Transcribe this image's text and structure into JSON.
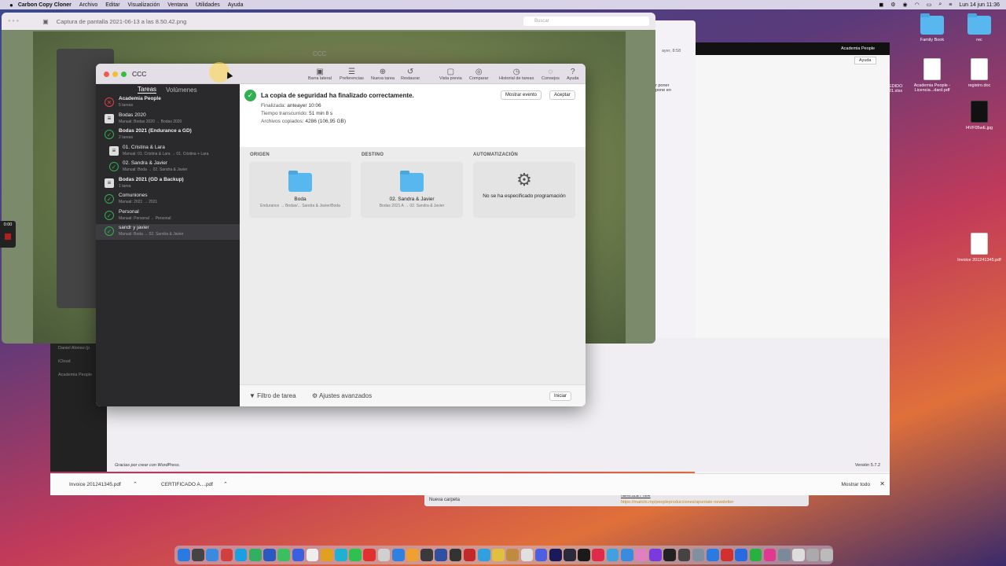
{
  "menubar": {
    "app_name": "Carbon Copy Cloner",
    "items": [
      "Archivo",
      "Editar",
      "Visualización",
      "Ventana",
      "Utilidades",
      "Ayuda"
    ],
    "clock": "Lun 14 jun  11:36"
  },
  "desktop": {
    "icons": [
      {
        "label": "Family Book",
        "kind": "folder"
      },
      {
        "label": "rec",
        "kind": "folder"
      },
      {
        "label": "Academia People - Licencia...dard.pdf",
        "kind": "doc"
      },
      {
        "label": "registro.doc",
        "kind": "doc"
      },
      {
        "label": "I4VF05wE.jpg",
        "kind": "doc"
      },
      {
        "label": "Invoice 201241345.pdf",
        "kind": "doc"
      }
    ],
    "partial_label": "EDIDO\n21.xlsx"
  },
  "preview_window": {
    "title": "Captura de pantalla 2021-06-13 a las 8.50.42.png",
    "search_placeholder": "Buscar"
  },
  "behind_ccc_title": "CCC",
  "browser": {
    "right_header_text": "Academia People",
    "help_label": "Ayuda",
    "snippet_1": "ayer, 8:58",
    "snippet_2": "r poner\npone en",
    "wp_footer": "Gracias por crear con WordPress.",
    "wp_version": "Versión 5.7.2",
    "sidebar_text_1": "Daniel Alonso (p",
    "sidebar_text_2": "iCloud",
    "sidebar_text_3": "Academia People"
  },
  "downloads_bar": {
    "files": [
      "Invoice 201241345.pdf",
      "CERTIFICADO A....pdf"
    ],
    "show_all": "Mostrar todo"
  },
  "finder_bottom": {
    "new_folder": "Nueva carpeta",
    "newsletter_title": "NEWSLETTER",
    "newsletter_link": "https://mailchi.mp/peopleproducciones/apuntate-newsletter"
  },
  "timer": "0:00",
  "ccc": {
    "title": "CCC",
    "toolbar": [
      {
        "label": "Barra lateral",
        "icon": "sidebar-icon",
        "glyph": "▣"
      },
      {
        "label": "Preferencias",
        "icon": "preferences-icon",
        "glyph": "☰"
      },
      {
        "label": "Nueva tarea",
        "icon": "plus-icon",
        "glyph": "⊕"
      },
      {
        "label": "Restaurar",
        "icon": "restore-icon",
        "glyph": "↺"
      },
      {
        "label": "Vista previa",
        "icon": "preview-icon",
        "glyph": "▢"
      },
      {
        "label": "Comparar",
        "icon": "compare-icon",
        "glyph": "◎"
      },
      {
        "label": "Historial de tareas",
        "icon": "history-icon",
        "glyph": "◷"
      },
      {
        "label": "Consejos",
        "icon": "tips-icon",
        "glyph": "◌"
      },
      {
        "label": "Ayuda",
        "icon": "help-icon",
        "glyph": "?"
      }
    ],
    "sidebar": {
      "tab_tasks": "Tareas",
      "tab_volumes": "Volúmenes",
      "tasks": [
        {
          "name": "Academia People",
          "sub": "5 tareas",
          "status": "error",
          "kind": "group"
        },
        {
          "name": "Bodas 2020",
          "sub": "Manual: Bodas 2020 → Bodas 2020",
          "status": "stack",
          "kind": "task"
        },
        {
          "name": "Bodas 2021 (Endurance a GD)",
          "sub": "2 tareas",
          "status": "ok",
          "kind": "group"
        },
        {
          "name": "01. Cristina & Lara",
          "sub": "Manual: 01. Cristina & Lara → 01. Cristina + Lara",
          "status": "stack",
          "kind": "sub"
        },
        {
          "name": "02. Sandra & Javier",
          "sub": "Manual: Boda → 02. Sandra & Javier",
          "status": "ok",
          "kind": "sub"
        },
        {
          "name": "Bodas 2021 (GD a Backup)",
          "sub": "1 tarea",
          "status": "stack",
          "kind": "group"
        },
        {
          "name": "Comuniones",
          "sub": "Manual: 2021 → 2021",
          "status": "ok",
          "kind": "task"
        },
        {
          "name": "Personal",
          "sub": "Manual: Personal → Personal",
          "status": "ok",
          "kind": "task"
        },
        {
          "name": "sandr y javier",
          "sub": "Manual: Boda → 02. Sandra & Javier",
          "status": "ok",
          "kind": "task",
          "selected": true
        }
      ]
    },
    "status": {
      "message": "La copia de seguridad ha finalizado correctamente.",
      "finished_label": "Finalizada",
      "finished_value": ": anteayer 10:06",
      "elapsed_label": "Tiempo transcurrido",
      "elapsed_value": ": 51 min 8 s",
      "files_label": "Archivos copiados",
      "files_value": ": 4286 (106,95 GB)",
      "show_event": "Mostrar evento",
      "accept": "Aceptar"
    },
    "source": {
      "header": "ORIGEN",
      "name": "Boda",
      "path": "Endurance → Bodas/... Sandra & Javier/Boda"
    },
    "destination": {
      "header": "DESTINO",
      "name": "02. Sandra & Javier",
      "path": "Bodas 2021 A → 02. Sandra & Javier"
    },
    "automation": {
      "header": "AUTOMATIZACIÓN",
      "text": "No se ha especificado programación"
    },
    "footer": {
      "filter": "Filtro de tarea",
      "advanced": "Ajustes avanzados",
      "start": "Iniciar"
    }
  },
  "colors": {
    "success": "#30b050",
    "error": "#e04040",
    "sidebar_bg": "#2a2a2c",
    "folder": "#57b7ee"
  }
}
